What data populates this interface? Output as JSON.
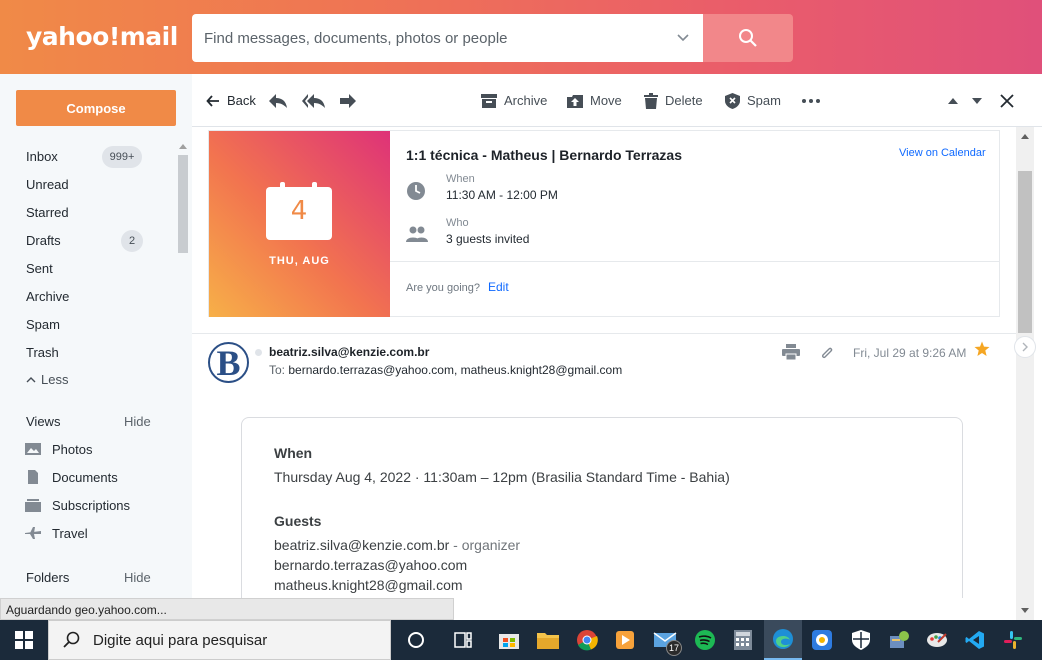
{
  "header": {
    "logo": "yahoo!mail",
    "search_placeholder": "Find messages, documents, photos or people"
  },
  "sidebar": {
    "compose_label": "Compose",
    "folders": [
      {
        "label": "Inbox",
        "count": "999+"
      },
      {
        "label": "Unread"
      },
      {
        "label": "Starred"
      },
      {
        "label": "Drafts",
        "count": "2"
      },
      {
        "label": "Sent"
      },
      {
        "label": "Archive"
      },
      {
        "label": "Spam"
      },
      {
        "label": "Trash"
      }
    ],
    "less_label": "Less",
    "views_title": "Views",
    "views_hide": "Hide",
    "views": [
      {
        "label": "Photos",
        "icon": "photo-icon"
      },
      {
        "label": "Documents",
        "icon": "document-icon"
      },
      {
        "label": "Subscriptions",
        "icon": "subscriptions-icon"
      },
      {
        "label": "Travel",
        "icon": "airplane-icon"
      }
    ],
    "folders_title": "Folders",
    "folders_hide": "Hide"
  },
  "toolbar": {
    "back_label": "Back",
    "archive_label": "Archive",
    "move_label": "Move",
    "delete_label": "Delete",
    "spam_label": "Spam"
  },
  "event": {
    "day": "4",
    "date_label": "THU, AUG",
    "title": "1:1 técnica - Matheus | Bernardo Terrazas",
    "view_calendar": "View on Calendar",
    "when_label": "When",
    "when_value": "11:30 AM - 12:00 PM",
    "who_label": "Who",
    "who_value": "3 guests invited",
    "going_question": "Are you going?",
    "edit_label": "Edit"
  },
  "message": {
    "avatar_letter": "B",
    "from": "beatriz.silva@kenzie.com.br",
    "to_label": "To:",
    "to": "bernardo.terrazas@yahoo.com,  matheus.knight28@gmail.com",
    "date": "Fri, Jul 29 at 9:26 AM",
    "starred": true,
    "star_color": "#f5a623"
  },
  "invite": {
    "when_heading": "When",
    "when_text": "Thursday Aug 4, 2022 · 11:30am – 12pm (Brasilia Standard Time - Bahia)",
    "guests_heading": "Guests",
    "guests": [
      {
        "email": "beatriz.silva@kenzie.com.br",
        "role": " - organizer"
      },
      {
        "email": "bernardo.terrazas@yahoo.com",
        "role": ""
      },
      {
        "email": "matheus.knight28@gmail.com",
        "role": ""
      }
    ]
  },
  "status_text": "Aguardando geo.yahoo.com...",
  "taskbar": {
    "search_placeholder": "Digite aqui para pesquisar",
    "mail_badge": "17",
    "apps": [
      "task-view-icon",
      "store-icon",
      "file-explorer-icon",
      "chrome-icon",
      "media-player-icon",
      "mail-icon",
      "spotify-icon",
      "calculator-icon",
      "edge-icon",
      "ship-app-icon",
      "defender-icon",
      "device-app-icon",
      "paint-icon",
      "vscode-icon",
      "slack-icon"
    ]
  }
}
